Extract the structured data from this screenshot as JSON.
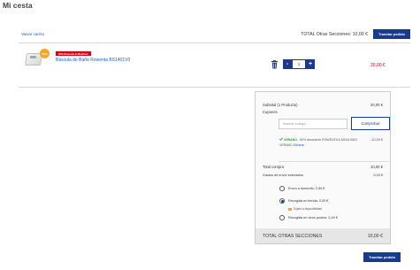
{
  "page_title": "Mi cesta",
  "cart": {
    "empty_link": "Vaciar carrito",
    "total_other_sections": "TOTAL Otras Secciones: 10,00 €",
    "checkout_label": "Tramitar pedido"
  },
  "product": {
    "promo_badge": "30% Rowenta & Moulinex",
    "percent_badge": "30%",
    "name": "Báscula de Baño Rowenta BS1401V0",
    "quantity": "1",
    "minus": "-",
    "plus": "+",
    "price": "20,00 €"
  },
  "summary": {
    "subtotal_label": "Subtotal (1 Producto)",
    "subtotal_value": "20,00 €",
    "coupons_label": "Cupones",
    "coupon_placeholder": "Insertar código...",
    "apply_button": "Comprobar",
    "coupon_code": "VERANO",
    "coupon_description": " - 50% descuento ROWENTA & MOULINEX VERANO ",
    "coupon_remove": "Eliminar",
    "coupon_discount": "-10,00 €",
    "total_compra_label": "Total compra",
    "total_compra_value": "10,00 €",
    "shipping_label": "Gastos de envío estimados",
    "shipping_value": "0,00 €",
    "shipping_options": [
      {
        "label": "Envío a domicilio: 2,59 €",
        "selected": false
      },
      {
        "label": "Recogida en tienda: 0,00 €",
        "selected": true
      },
      {
        "label": "Recogida en otros puntos: 2,49 €",
        "selected": false
      }
    ],
    "availability_note": "Sujeto a disponibilidad",
    "total_label": "TOTAL OTRAS SECCIONES",
    "total_value": "10,00 €"
  },
  "colors": {
    "primary": "#1a3a8f",
    "link": "#1e5ec4",
    "price_red": "#d0021b",
    "success": "#2a9d3c",
    "badge_orange": "#f5a623"
  },
  "icons": [
    "trash-icon",
    "check-icon",
    "store-icon"
  ]
}
